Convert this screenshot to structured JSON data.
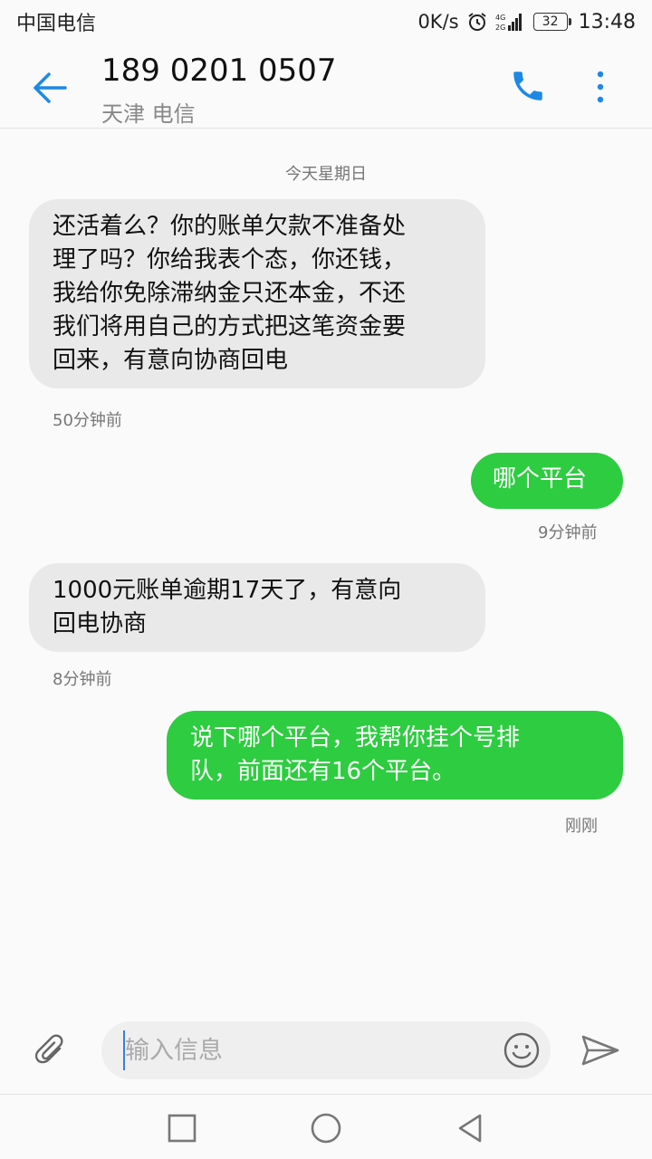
{
  "status_bar": {
    "carrier": "中国电信",
    "net_speed": "0K/s",
    "battery": "32",
    "time": "13:48",
    "icons": [
      "alarm-icon",
      "signal-4g-icon",
      "battery-icon"
    ]
  },
  "header": {
    "contact_number": "189 0201 0507",
    "contact_location": "天津 电信",
    "icons": [
      "back-arrow-icon",
      "phone-icon",
      "more-vertical-icon"
    ],
    "accent_color": "#1e88e5"
  },
  "conversation": {
    "date_separator": "今天星期日",
    "messages": [
      {
        "direction": "incoming",
        "lines": [
          "还活着么？你的账单欠款不准备处",
          "理了吗？你给我表个态，你还钱，",
          "我给你免除滞纳金只还本金，不还",
          "我们将用自己的方式把这笔资金要",
          "回来，有意向协商回电"
        ],
        "time": "50分钟前"
      },
      {
        "direction": "outgoing",
        "lines": [
          "哪个平台"
        ],
        "time": "9分钟前"
      },
      {
        "direction": "incoming",
        "lines": [
          "1000元账单逾期17天了，有意向",
          "回电协商"
        ],
        "time": "8分钟前"
      },
      {
        "direction": "outgoing",
        "lines": [
          "说下哪个平台，我帮你挂个号排",
          "队，前面还有16个平台。"
        ],
        "time": "刚刚"
      }
    ],
    "colors": {
      "incoming_bubble": "#e9e9e9",
      "outgoing_bubble": "#2ecc40"
    }
  },
  "composer": {
    "placeholder": "输入信息",
    "value": "",
    "icons": [
      "paperclip-icon",
      "emoji-icon",
      "send-icon"
    ]
  },
  "nav_bar": {
    "icons": [
      "recent-apps-icon",
      "home-icon",
      "back-icon"
    ]
  }
}
